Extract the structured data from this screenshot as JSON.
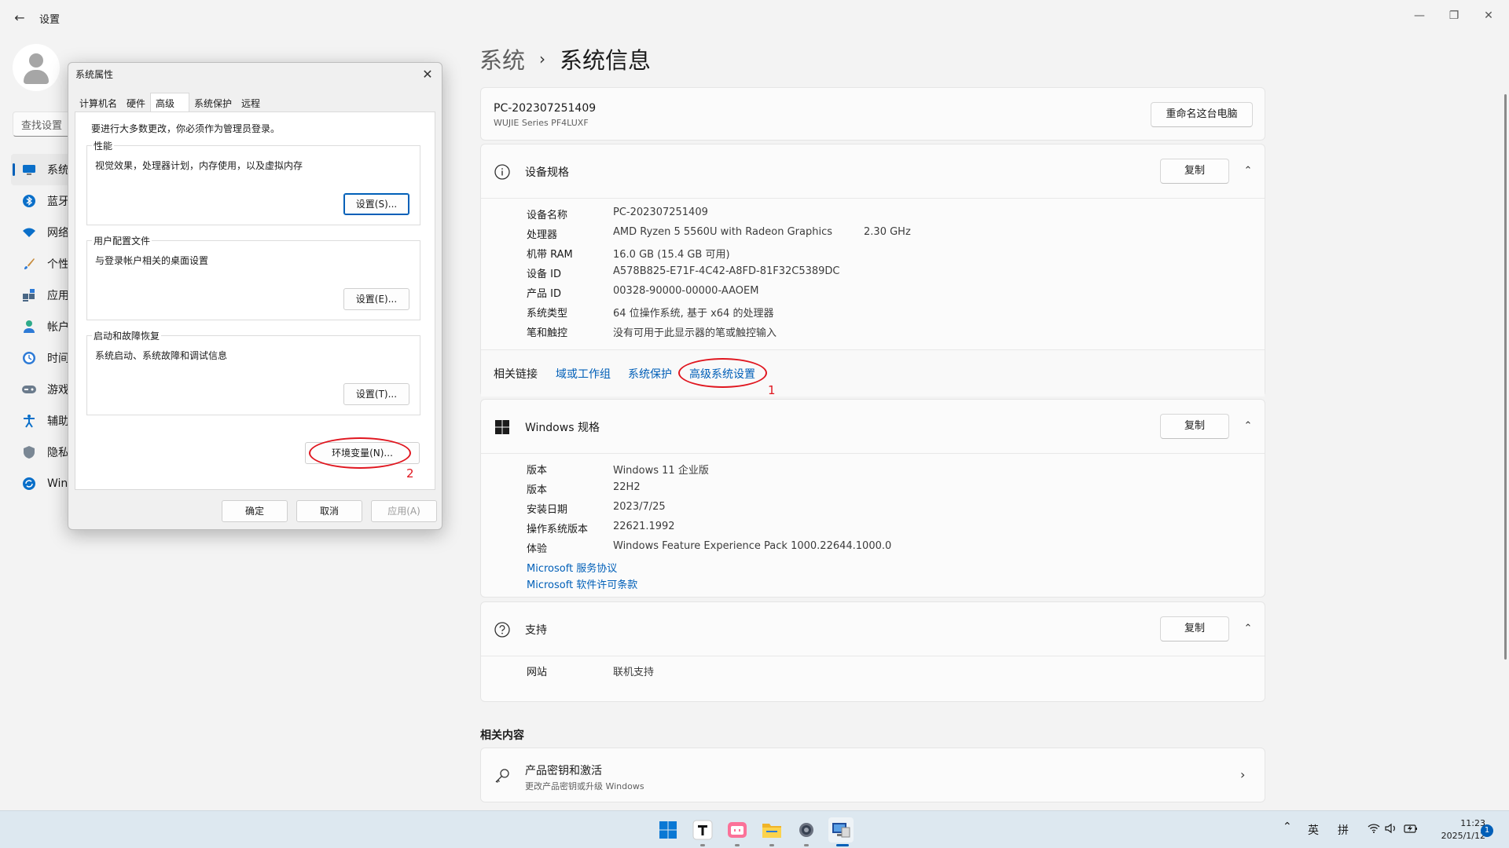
{
  "window": {
    "title": "设置"
  },
  "nav": {
    "search_placeholder": "查找设置",
    "items": [
      {
        "label": "系统",
        "icon": "monitor-icon",
        "selected": true
      },
      {
        "label": "蓝牙",
        "icon": "bluetooth-icon"
      },
      {
        "label": "网络",
        "icon": "wifi-icon"
      },
      {
        "label": "个性",
        "icon": "brush-icon"
      },
      {
        "label": "应用",
        "icon": "apps-icon"
      },
      {
        "label": "帐户",
        "icon": "person-icon"
      },
      {
        "label": "时间",
        "icon": "clock-icon"
      },
      {
        "label": "游戏",
        "icon": "gamepad-icon"
      },
      {
        "label": "辅助",
        "icon": "accessibility-icon"
      },
      {
        "label": "隐私",
        "icon": "shield-icon"
      },
      {
        "label": "Wind",
        "icon": "update-icon"
      }
    ]
  },
  "breadcrumb": {
    "parent": "系统",
    "separator": "›",
    "current": "系统信息"
  },
  "pc": {
    "name": "PC-202307251409",
    "model": "WUJIE Series PF4LUXF",
    "rename_label": "重命名这台电脑"
  },
  "device_specs": {
    "title": "设备规格",
    "copy_label": "复制",
    "rows": [
      {
        "key": "设备名称",
        "value": "PC-202307251409"
      },
      {
        "key": "处理器",
        "value": "AMD Ryzen 5 5560U with Radeon Graphics",
        "extra": "2.30 GHz"
      },
      {
        "key": "机带 RAM",
        "value": "16.0 GB (15.4 GB 可用)"
      },
      {
        "key": "设备 ID",
        "value": "A578B825-E71F-4C42-A8FD-81F32C5389DC"
      },
      {
        "key": "产品 ID",
        "value": "00328-90000-00000-AAOEM"
      },
      {
        "key": "系统类型",
        "value": "64 位操作系统, 基于 x64 的处理器"
      },
      {
        "key": "笔和触控",
        "value": "没有可用于此显示器的笔或触控输入"
      }
    ]
  },
  "related_links": {
    "title": "相关链接",
    "links": [
      "域或工作组",
      "系统保护",
      "高级系统设置"
    ],
    "annotation": "1"
  },
  "windows_specs": {
    "title": "Windows 规格",
    "copy_label": "复制",
    "rows": [
      {
        "key": "版本",
        "value": "Windows 11 企业版"
      },
      {
        "key": "版本",
        "value": "22H2"
      },
      {
        "key": "安装日期",
        "value": "2023/7/25"
      },
      {
        "key": "操作系统版本",
        "value": "22621.1992"
      },
      {
        "key": "体验",
        "value": "Windows Feature Experience Pack 1000.22644.1000.0"
      }
    ],
    "links": [
      "Microsoft 服务协议",
      "Microsoft 软件许可条款"
    ]
  },
  "support": {
    "title": "支持",
    "copy_label": "复制",
    "row": {
      "key": "网站",
      "value": "联机支持"
    }
  },
  "related_content": {
    "title": "相关内容",
    "item_title": "产品密钥和激活",
    "item_subtitle": "更改产品密钥或升级 Windows"
  },
  "dialog": {
    "title": "系统属性",
    "tabs": [
      "计算机名",
      "硬件",
      "高级",
      "系统保护",
      "远程"
    ],
    "active_tab": "高级",
    "admin_note": "要进行大多数更改，你必须作为管理员登录。",
    "groups": [
      {
        "title": "性能",
        "desc": "视觉效果，处理器计划，内存使用，以及虚拟内存",
        "button": "设置(S)..."
      },
      {
        "title": "用户配置文件",
        "desc": "与登录帐户相关的桌面设置",
        "button": "设置(E)..."
      },
      {
        "title": "启动和故障恢复",
        "desc": "系统启动、系统故障和调试信息",
        "button": "设置(T)..."
      }
    ],
    "env_button": "环境变量(N)...",
    "annotation": "2",
    "ok": "确定",
    "cancel": "取消",
    "apply": "应用(A)"
  },
  "taskbar": {
    "apps": [
      "windows-start-icon",
      "typora-icon",
      "bilibili-icon",
      "file-explorer-icon",
      "settings-icon",
      "system-properties-icon"
    ],
    "tray_lang": "英",
    "tray_ime": "拼",
    "time": "11:23",
    "date": "2025/1/12",
    "notifications": "1"
  },
  "colors": {
    "accent": "#005fb8",
    "annotation": "#e0161f"
  }
}
